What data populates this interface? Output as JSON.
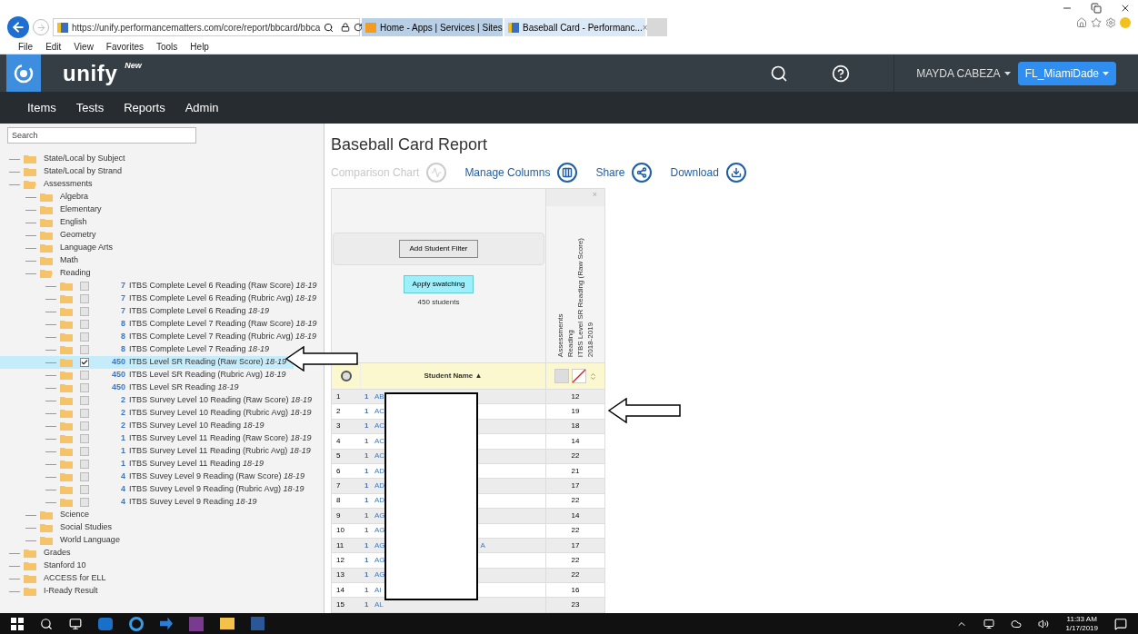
{
  "browser": {
    "address": "https://unify.performancematters.com/core/report/bbcard/bbca",
    "tabs": [
      {
        "title": "Home - Apps | Services | Sites",
        "selected": false
      },
      {
        "title": "Baseball Card - Performanc...",
        "selected": true
      }
    ],
    "tab_close": "×",
    "menu": [
      "File",
      "Edit",
      "View",
      "Favorites",
      "Tools",
      "Help"
    ]
  },
  "app": {
    "brand": "unify",
    "brand_badge": "New",
    "user": "MAYDA CABEZA",
    "district": "FL_MiamiDade",
    "nav": [
      "Items",
      "Tests",
      "Reports",
      "Admin"
    ]
  },
  "sidebar": {
    "search_placeholder": "Search",
    "tree": [
      {
        "label": "State/Local by Subject",
        "expanded": false
      },
      {
        "label": "State/Local by Strand",
        "expanded": false
      },
      {
        "label": "Assessments",
        "expanded": true,
        "children": [
          {
            "label": "Algebra",
            "expanded": false
          },
          {
            "label": "Elementary",
            "expanded": false
          },
          {
            "label": "English",
            "expanded": false
          },
          {
            "label": "Geometry",
            "expanded": false
          },
          {
            "label": "Language Arts",
            "expanded": false
          },
          {
            "label": "Math",
            "expanded": false
          },
          {
            "label": "Reading",
            "expanded": true,
            "tests": [
              {
                "count": "7",
                "label": "ITBS Complete Level 6 Reading (Raw Score)",
                "year": "18-19",
                "checked": false,
                "selected": false
              },
              {
                "count": "7",
                "label": "ITBS Complete Level 6 Reading (Rubric Avg)",
                "year": "18-19",
                "checked": false,
                "selected": false
              },
              {
                "count": "7",
                "label": "ITBS Complete Level 6 Reading",
                "year": "18-19",
                "checked": false,
                "selected": false
              },
              {
                "count": "8",
                "label": "ITBS Complete Level 7 Reading (Raw Score)",
                "year": "18-19",
                "checked": false,
                "selected": false
              },
              {
                "count": "8",
                "label": "ITBS Complete Level 7 Reading (Rubric Avg)",
                "year": "18-19",
                "checked": false,
                "selected": false
              },
              {
                "count": "8",
                "label": "ITBS Complete Level 7 Reading",
                "year": "18-19",
                "checked": false,
                "selected": false
              },
              {
                "count": "450",
                "label": "ITBS Level SR Reading (Raw Score)",
                "year": "18-19",
                "checked": true,
                "selected": true
              },
              {
                "count": "450",
                "label": "ITBS Level SR Reading (Rubric Avg)",
                "year": "18-19",
                "checked": false,
                "selected": false
              },
              {
                "count": "450",
                "label": "ITBS Level SR Reading",
                "year": "18-19",
                "checked": false,
                "selected": false
              },
              {
                "count": "2",
                "label": "ITBS Survey Level 10 Reading (Raw Score)",
                "year": "18-19",
                "checked": false,
                "selected": false
              },
              {
                "count": "2",
                "label": "ITBS Survey Level 10 Reading (Rubric Avg)",
                "year": "18-19",
                "checked": false,
                "selected": false
              },
              {
                "count": "2",
                "label": "ITBS Survey Level 10 Reading",
                "year": "18-19",
                "checked": false,
                "selected": false
              },
              {
                "count": "1",
                "label": "ITBS Survey Level 11 Reading (Raw Score)",
                "year": "18-19",
                "checked": false,
                "selected": false
              },
              {
                "count": "1",
                "label": "ITBS Survey Level 11 Reading (Rubric Avg)",
                "year": "18-19",
                "checked": false,
                "selected": false
              },
              {
                "count": "1",
                "label": "ITBS Survey Level 11 Reading",
                "year": "18-19",
                "checked": false,
                "selected": false
              },
              {
                "count": "4",
                "label": "ITBS Suvey Level 9 Reading (Raw Score)",
                "year": "18-19",
                "checked": false,
                "selected": false
              },
              {
                "count": "4",
                "label": "ITBS Suvey Level 9 Reading (Rubric Avg)",
                "year": "18-19",
                "checked": false,
                "selected": false
              },
              {
                "count": "4",
                "label": "ITBS Suvey Level 9 Reading",
                "year": "18-19",
                "checked": false,
                "selected": false
              }
            ]
          },
          {
            "label": "Science",
            "expanded": false
          },
          {
            "label": "Social Studies",
            "expanded": false
          },
          {
            "label": "World Language",
            "expanded": false
          }
        ]
      },
      {
        "label": "Grades",
        "expanded": false
      },
      {
        "label": "Stanford 10",
        "expanded": false
      },
      {
        "label": "ACCESS for ELL",
        "expanded": false
      },
      {
        "label": "I-Ready Result",
        "expanded": false
      }
    ]
  },
  "report": {
    "title": "Baseball Card Report",
    "actions": [
      {
        "label": "Comparison Chart",
        "kind": "chart",
        "disabled": true
      },
      {
        "label": "Manage Columns",
        "kind": "columns",
        "disabled": false
      },
      {
        "label": "Share",
        "kind": "share",
        "disabled": false
      },
      {
        "label": "Download",
        "kind": "download",
        "disabled": false
      }
    ],
    "filter_button": "Add Student Filter",
    "swatch_button": "Apply swatching",
    "student_count": "450 students",
    "column_close": "×",
    "column_heading": [
      "Assessments",
      "Reading",
      "ITBS Level SR Reading (Raw Score)",
      "2018-2019"
    ],
    "name_header": "Student Name ▲",
    "rows": [
      {
        "index": "1",
        "count": "1",
        "name": "AB",
        "score": "12"
      },
      {
        "index": "2",
        "count": "1",
        "name": "AC",
        "score": "19"
      },
      {
        "index": "3",
        "count": "1",
        "name": "AC",
        "score": "18"
      },
      {
        "index": "4",
        "count": "1",
        "name": "AC",
        "score": "14"
      },
      {
        "index": "5",
        "count": "1",
        "name": "AC",
        "score": "22"
      },
      {
        "index": "6",
        "count": "1",
        "name": "AD",
        "score": "21"
      },
      {
        "index": "7",
        "count": "1",
        "name": "AD",
        "score": "17"
      },
      {
        "index": "8",
        "count": "1",
        "name": "AD",
        "score": "22"
      },
      {
        "index": "9",
        "count": "1",
        "name": "AG",
        "score": "14"
      },
      {
        "index": "10",
        "count": "1",
        "name": "AG",
        "score": "22"
      },
      {
        "index": "11",
        "count": "1",
        "name": "AG",
        "name_end": "A",
        "score": "17"
      },
      {
        "index": "12",
        "count": "1",
        "name": "AG",
        "score": "22"
      },
      {
        "index": "13",
        "count": "1",
        "name": "AG",
        "score": "22"
      },
      {
        "index": "14",
        "count": "1",
        "name": "AI",
        "score": "16"
      },
      {
        "index": "15",
        "count": "1",
        "name": "AL",
        "score": "23"
      }
    ]
  },
  "taskbar": {
    "time": "11:33 AM",
    "date": "1/17/2019"
  }
}
